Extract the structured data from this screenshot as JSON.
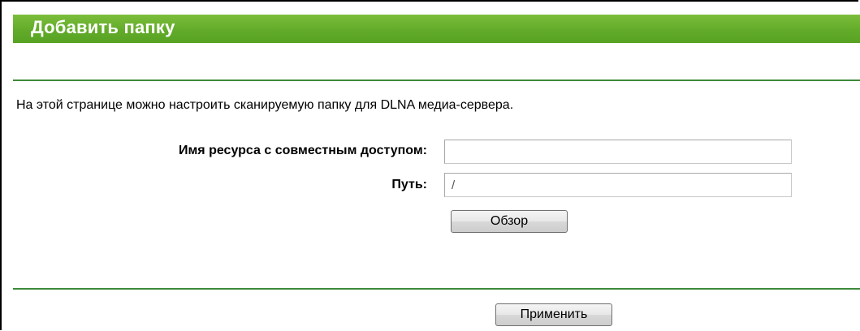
{
  "header": {
    "title": "Добавить папку"
  },
  "main": {
    "description": "На этой странице можно настроить сканируемую папку для DLNA медиа-сервера.",
    "share_name": {
      "label": "Имя ресурса с совместным доступом:",
      "value": ""
    },
    "path": {
      "label": "Путь:",
      "value": "/"
    },
    "browse_label": "Обзор"
  },
  "footer": {
    "apply_label": "Применить"
  },
  "colors": {
    "header_green": "#62ab2a",
    "divider_green": "#3c8a3a"
  }
}
